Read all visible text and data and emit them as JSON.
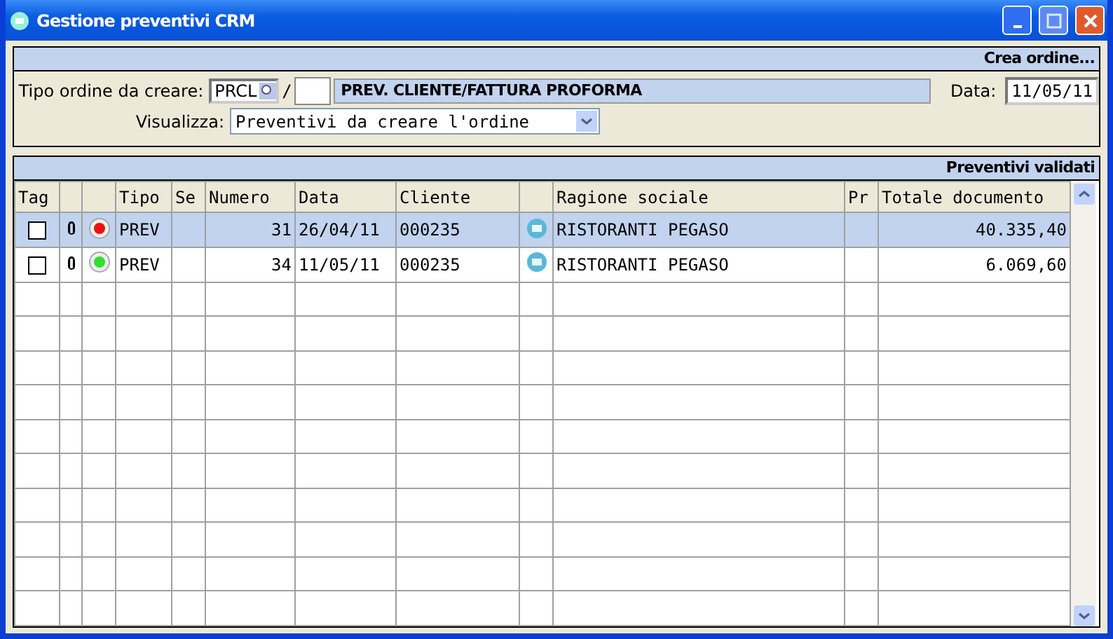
{
  "window": {
    "title": "Gestione preventivi CRM"
  },
  "order_panel": {
    "title": "Crea ordine...",
    "type_label": "Tipo ordine da creare:",
    "type_code": "PRCL",
    "separator": "/",
    "type_description": "PREV. CLIENTE/FATTURA PROFORMA",
    "date_label": "Data:",
    "date": "11/05/11",
    "view_label": "Visualizza:",
    "view_value": "Preventivi da creare l'ordine"
  },
  "table": {
    "title": "Preventivi validati",
    "columns": [
      "Tag",
      "Tipo",
      "Se",
      "Numero",
      "Data",
      "Cliente",
      "Ragione sociale",
      "Pr",
      "Totale documento"
    ],
    "rows": [
      {
        "selected": true,
        "checked": false,
        "color": "#ee1111",
        "tipo": "PREV",
        "numero": "31",
        "data": "26/04/11",
        "cliente": "000235",
        "ragione": "RISTORANTI PEGASO",
        "totale": "40.335,40"
      },
      {
        "selected": false,
        "checked": false,
        "color": "#33dd33",
        "tipo": "PREV",
        "numero": "34",
        "data": "11/05/11",
        "cliente": "000235",
        "ragione": "RISTORANTI PEGASO",
        "totale": "6.069,60"
      }
    ]
  }
}
